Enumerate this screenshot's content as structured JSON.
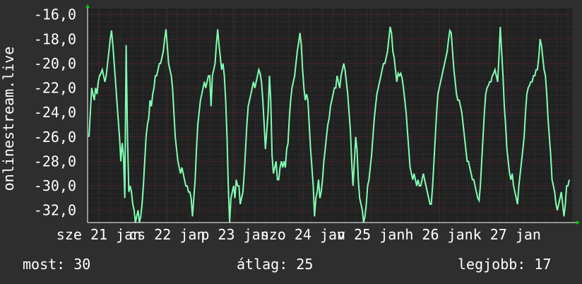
{
  "colors": {
    "background": "#2e2e2e",
    "plot_background": "#212121",
    "grid_major": "#6b2a2a",
    "grid_minor": "#3a3a3a",
    "line": "#80ffb4",
    "axis": "#ffffff",
    "arrow": "#00cc00"
  },
  "stats": {
    "current": "most: 30",
    "average": "átlag: 25",
    "best": "legjobb: 17"
  },
  "chart_data": {
    "type": "line",
    "title": "",
    "ylabel": "onlinestream.live",
    "xlabel": "",
    "ylim": [
      -33,
      -15.5
    ],
    "y_ticks": [
      -32,
      -30,
      -28,
      -26,
      -24,
      -22,
      -20,
      -18,
      -16
    ],
    "y_tick_labels": [
      "-32,0",
      "-30,0",
      "-28,0",
      "-26,0",
      "-24,0",
      "-22,0",
      "-20,0",
      "-18,0",
      "-16,0"
    ],
    "x_tick_labels": [
      "sze 21 jan",
      "cs 22 jan",
      "p 23 jan",
      "szo 24 jan",
      "v 25 jan",
      "h 26 jan",
      "k 27 jan"
    ],
    "grid": true,
    "series": [
      {
        "values": [
          -26.0,
          -24.0,
          -22.0,
          -22.5,
          -23.0,
          -22.0,
          -22.5,
          -21.5,
          -21.0,
          -20.8,
          -20.5,
          -21.0,
          -21.5,
          -21.0,
          -20.0,
          -19.0,
          -18.0,
          -17.3,
          -18.5,
          -20.0,
          -21.5,
          -23.0,
          -24.5,
          -26.0,
          -28.0,
          -26.5,
          -27.5,
          -31.0,
          -18.5,
          -26.0,
          -30.5,
          -30.0,
          -30.5,
          -31.5,
          -32.0,
          -33.0,
          -32.5,
          -32.0,
          -33.0,
          -32.5,
          -31.5,
          -30.0,
          -28.0,
          -26.0,
          -25.0,
          -24.5,
          -23.0,
          -23.5,
          -22.5,
          -22.0,
          -21.0,
          -21.0,
          -20.5,
          -20.0,
          -20.0,
          -19.5,
          -19.0,
          -18.0,
          -17.2,
          -18.5,
          -20.0,
          -20.5,
          -21.0,
          -22.0,
          -24.0,
          -26.0,
          -27.0,
          -28.0,
          -28.5,
          -29.0,
          -28.5,
          -29.0,
          -29.5,
          -30.0,
          -30.0,
          -30.5,
          -30.5,
          -31.0,
          -32.5,
          -31.0,
          -29.5,
          -27.0,
          -25.0,
          -24.0,
          -23.0,
          -22.5,
          -22.0,
          -21.5,
          -22.0,
          -21.5,
          -21.0,
          -21.0,
          -23.5,
          -21.0,
          -20.5,
          -20.0,
          -18.5,
          -17.2,
          -18.5,
          -19.5,
          -20.5,
          -20.0,
          -21.0,
          -23.0,
          -26.0,
          -30.0,
          -33.0,
          -31.0,
          -30.5,
          -30.0,
          -31.0,
          -29.5,
          -30.0,
          -30.0,
          -31.5,
          -31.0,
          -30.5,
          -29.0,
          -27.0,
          -25.0,
          -23.5,
          -23.0,
          -22.5,
          -22.0,
          -21.5,
          -22.0,
          -21.5,
          -21.0,
          -20.5,
          -20.8,
          -21.5,
          -23.0,
          -25.0,
          -27.0,
          -25.5,
          -24.0,
          -21.0,
          -23.0,
          -27.5,
          -29.0,
          -28.5,
          -28.0,
          -29.5,
          -29.5,
          -28.5,
          -28.0,
          -28.5,
          -28.0,
          -28.5,
          -27.0,
          -26.5,
          -24.5,
          -23.0,
          -22.0,
          -21.5,
          -21.0,
          -20.0,
          -19.0,
          -18.3,
          -17.5,
          -18.5,
          -20.5,
          -22.0,
          -23.0,
          -22.5,
          -23.0,
          -25.0,
          -27.0,
          -28.5,
          -30.0,
          -32.5,
          -31.0,
          -30.5,
          -29.5,
          -31.0,
          -30.5,
          -29.5,
          -28.0,
          -27.0,
          -26.0,
          -25.0,
          -24.5,
          -23.5,
          -23.0,
          -22.5,
          -22.0,
          -22.0,
          -21.0,
          -21.5,
          -22.0,
          -21.0,
          -20.5,
          -20.0,
          -20.5,
          -21.5,
          -22.5,
          -24.0,
          -25.5,
          -28.0,
          -30.0,
          -28.0,
          -26.0,
          -27.0,
          -29.5,
          -31.0,
          -31.5,
          -32.0,
          -33.0,
          -32.5,
          -31.5,
          -30.0,
          -29.5,
          -28.5,
          -27.5,
          -26.0,
          -24.5,
          -23.5,
          -22.5,
          -22.0,
          -21.5,
          -21.0,
          -20.5,
          -20.0,
          -20.0,
          -19.5,
          -19.0,
          -18.0,
          -17.0,
          -17.5,
          -19.0,
          -19.5,
          -20.5,
          -21.5,
          -20.8,
          -21.0,
          -20.8,
          -21.2,
          -22.0,
          -23.0,
          -24.0,
          -25.5,
          -27.0,
          -28.5,
          -29.0,
          -29.5,
          -29.0,
          -29.5,
          -30.0,
          -29.5,
          -30.0,
          -30.0,
          -29.5,
          -29.0,
          -29.5,
          -30.0,
          -30.5,
          -31.0,
          -31.5,
          -31.5,
          -30.0,
          -28.0,
          -26.0,
          -24.0,
          -22.5,
          -22.0,
          -21.5,
          -21.0,
          -20.5,
          -20.0,
          -19.5,
          -19.0,
          -18.0,
          -17.3,
          -17.5,
          -19.0,
          -20.5,
          -21.5,
          -22.5,
          -23.0,
          -23.0,
          -23.5,
          -24.0,
          -25.0,
          -26.0,
          -27.0,
          -28.0,
          -28.0,
          -28.5,
          -29.0,
          -29.5,
          -29.5,
          -30.0,
          -30.5,
          -31.0,
          -31.2,
          -30.0,
          -28.0,
          -26.0,
          -24.0,
          -22.5,
          -22.0,
          -21.8,
          -21.5,
          -21.5,
          -21.0,
          -20.8,
          -20.5,
          -21.0,
          -21.5,
          -19.5,
          -17.0,
          -19.0,
          -21.0,
          -23.5,
          -25.0,
          -27.0,
          -28.0,
          -29.0,
          -29.5,
          -29.0,
          -30.0,
          -30.5,
          -31.0,
          -31.5,
          -30.0,
          -29.0,
          -28.0,
          -27.0,
          -26.0,
          -24.0,
          -22.5,
          -22.0,
          -21.8,
          -21.5,
          -21.5,
          -21.0,
          -21.0,
          -20.5,
          -20.5,
          -19.5,
          -18.0,
          -18.5,
          -19.5,
          -20.5,
          -21.0,
          -22.5,
          -24.5,
          -26.0,
          -27.5,
          -29.5,
          -30.0,
          -30.5,
          -31.5,
          -32.0,
          -31.5,
          -31.0,
          -30.5,
          -31.5,
          -32.5,
          -31.5,
          -30.0,
          -30.0,
          -29.5
        ]
      }
    ]
  }
}
